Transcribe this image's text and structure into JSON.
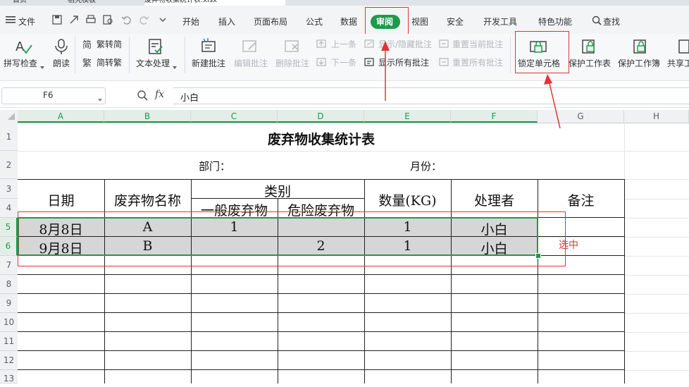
{
  "tabs": [
    "首页",
    "稻壳模板",
    "废弃物收集统计表.xlsx"
  ],
  "menu": {
    "file": "文件",
    "items": [
      "开始",
      "插入",
      "页面布局",
      "公式",
      "数据",
      "审阅",
      "视图",
      "安全",
      "开发工具",
      "特色功能"
    ],
    "active": "审阅",
    "search": "查找"
  },
  "ribbon": {
    "spell_check": "拼写检查",
    "read_aloud": "朗读",
    "trad_to_simp": "繁转简",
    "simp_to_trad": "简转繁",
    "text_process": "文本处理",
    "new_comment": "新建批注",
    "edit_comment": "编辑批注",
    "delete_comment": "删除批注",
    "prev": "上一条",
    "next": "下一条",
    "show_hide_comment": "显示/隐藏批注",
    "show_all_comments": "显示所有批注",
    "reset_current_comment": "重置当前批注",
    "reset_all_comments": "重置所有批注",
    "lock_cell": "锁定单元格",
    "protect_sheet": "保护工作表",
    "protect_workbook": "保护工作簿",
    "share_workbook": "共享工"
  },
  "formula_bar": {
    "name_box": "F6",
    "fx": "fx",
    "value": "小白"
  },
  "columns": [
    "A",
    "B",
    "C",
    "D",
    "E",
    "F",
    "G",
    "H"
  ],
  "rows": [
    "1",
    "2",
    "3",
    "4",
    "5",
    "6",
    "7",
    "8",
    "9",
    "10",
    "11",
    "12",
    "13"
  ],
  "sheet": {
    "title": "废弃物收集统计表",
    "department_label": "部门：",
    "month_label": "月份：",
    "headers": {
      "date": "日期",
      "waste_name": "废弃物名称",
      "category": "类别",
      "general_waste": "一般废弃物",
      "hazardous_waste": "危险废弃物",
      "quantity": "数量(KG)",
      "handler": "处理者",
      "remarks": "备注"
    },
    "data_rows": [
      {
        "date": "8月8日",
        "name": "A",
        "general": "1",
        "hazardous": "",
        "qty": "1",
        "handler": "小白"
      },
      {
        "date": "9月8日",
        "name": "B",
        "general": "",
        "hazardous": "2",
        "qty": "1",
        "handler": "小白"
      }
    ]
  },
  "annotation": {
    "selected_text": "选中"
  },
  "colors": {
    "accent_green": "#1e9a4c",
    "annotation_red": "#e03535"
  }
}
